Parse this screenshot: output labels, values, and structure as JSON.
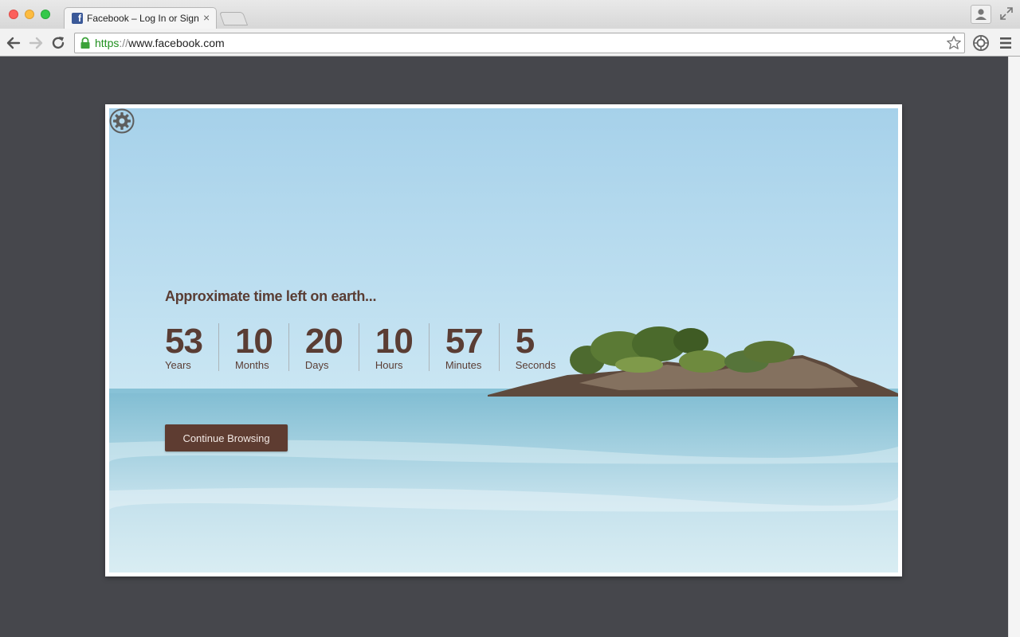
{
  "browser": {
    "tab_title": "Facebook – Log In or Sign Up",
    "tab_favicon": "f",
    "tab_close_glyph": "×",
    "url_scheme": "https",
    "url_separator": "://",
    "url_host": "www.facebook.com"
  },
  "page": {
    "headline": "Approximate time left on earth...",
    "countdown": [
      {
        "value": "53",
        "label": "Years"
      },
      {
        "value": "10",
        "label": "Months"
      },
      {
        "value": "20",
        "label": "Days"
      },
      {
        "value": "10",
        "label": "Hours"
      },
      {
        "value": "57",
        "label": "Minutes"
      },
      {
        "value": "5",
        "label": "Seconds"
      }
    ],
    "continue_label": "Continue Browsing"
  },
  "colors": {
    "accent": "#5e3c31",
    "text_brown": "#5a3d34",
    "page_background": "#46474c",
    "url_secure_green": "#21901f"
  },
  "icons": [
    "back-arrow-icon",
    "forward-arrow-icon",
    "reload-icon",
    "lock-icon",
    "star-icon",
    "extension-icon",
    "menu-icon",
    "profile-icon",
    "fullscreen-icon",
    "gear-icon"
  ]
}
